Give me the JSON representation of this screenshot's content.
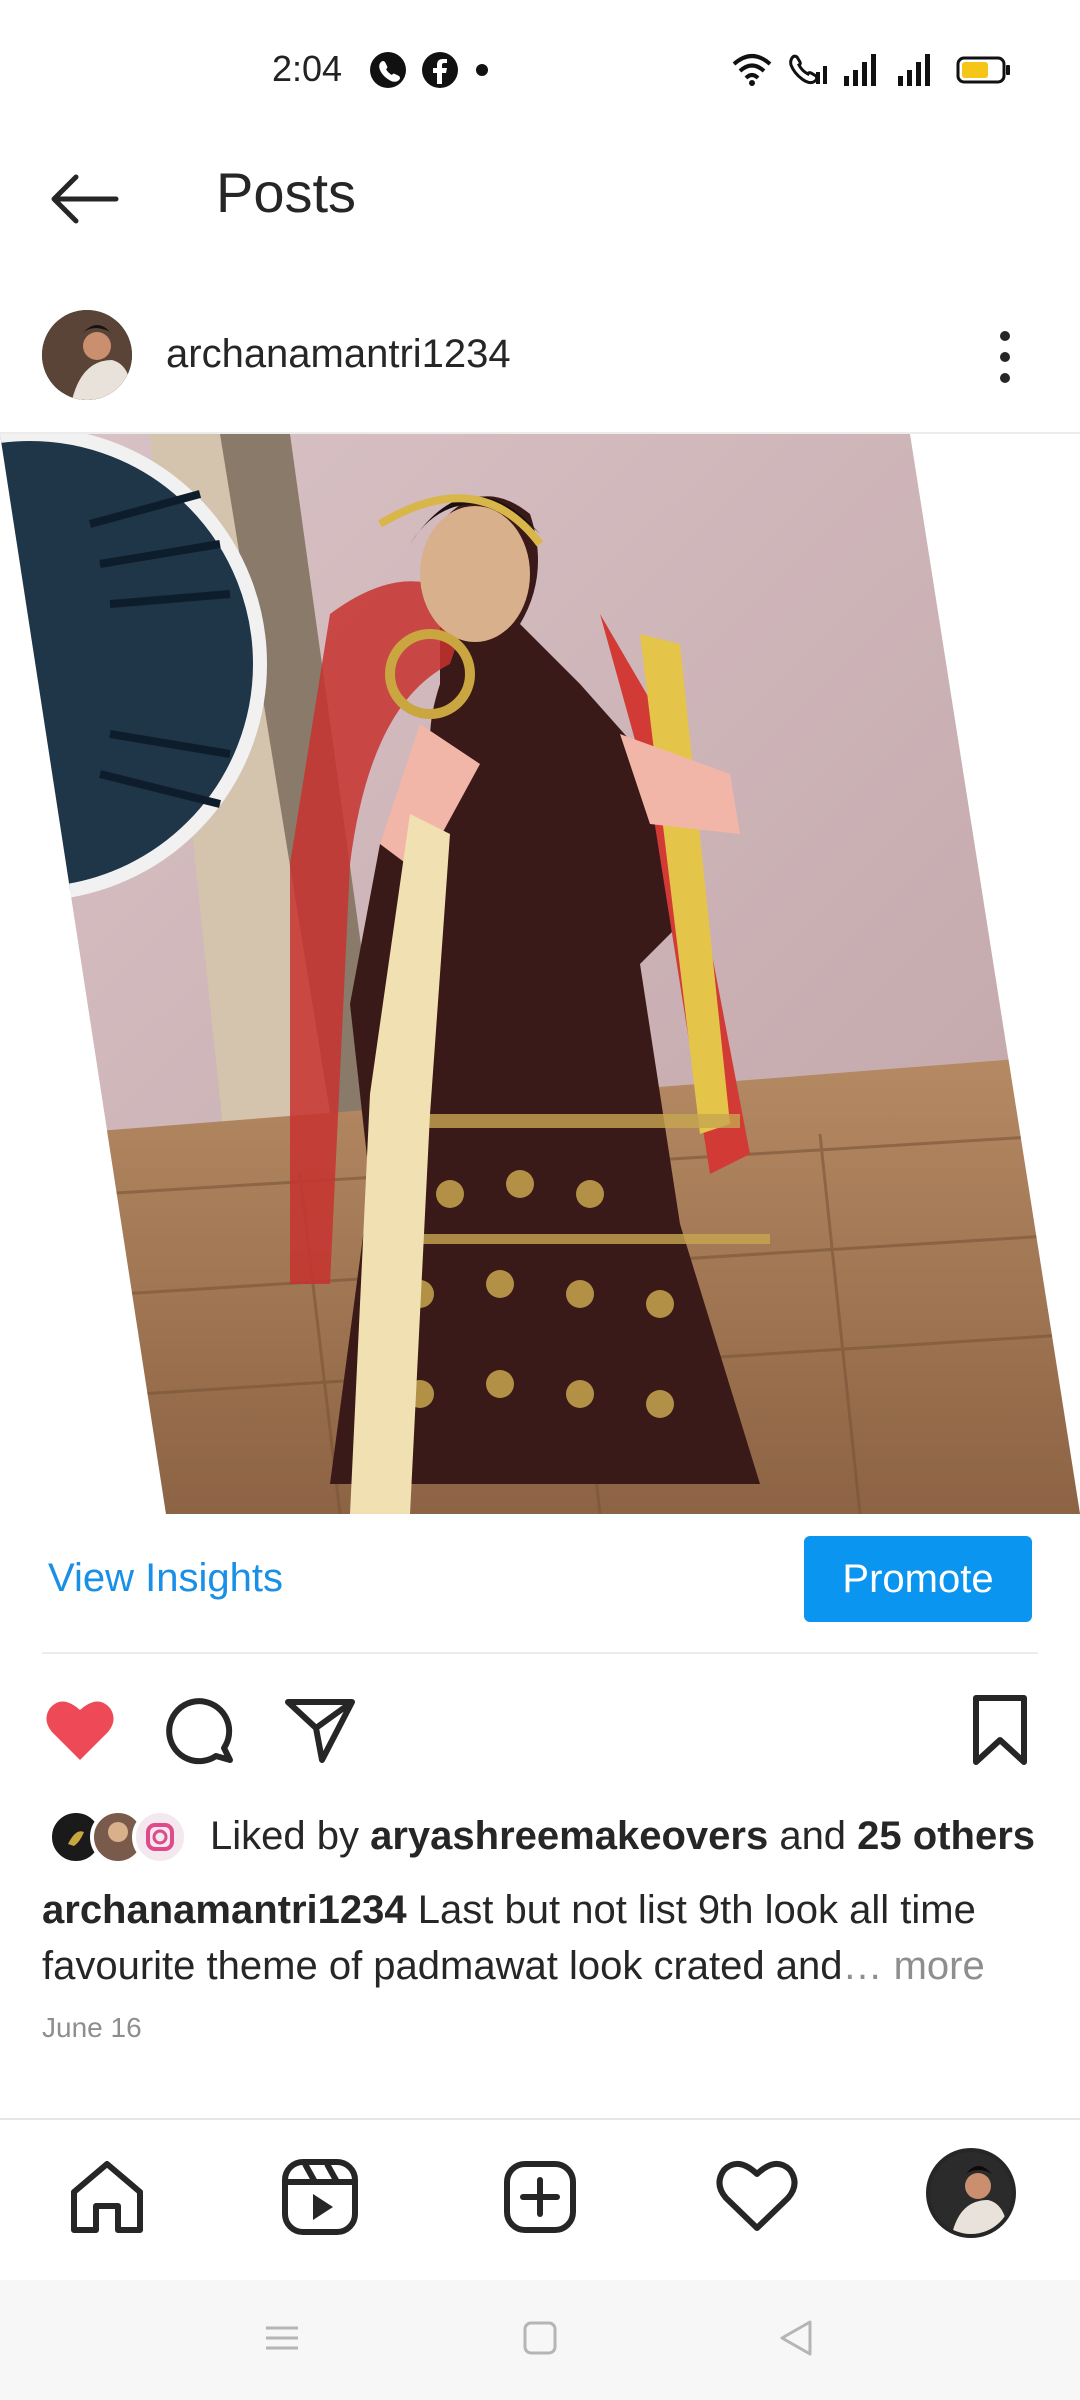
{
  "status_bar": {
    "time": "2:04",
    "icons": [
      "whatsapp-icon",
      "facebook-icon",
      "notification-dot-icon",
      "wifi-icon",
      "wifi-calling-icon",
      "signal-icon",
      "signal-icon",
      "battery-icon"
    ]
  },
  "header": {
    "title": "Posts",
    "back_icon": "back-arrow-icon"
  },
  "post": {
    "username": "archanamantri1234",
    "menu_icon": "more-vertical-icon",
    "insights": {
      "view_label": "View Insights",
      "promote_label": "Promote"
    },
    "actions": {
      "like_icon": "heart-filled-icon",
      "comment_icon": "comment-icon",
      "share_icon": "share-icon",
      "save_icon": "bookmark-icon"
    },
    "likes": {
      "prefix": "Liked by ",
      "user": "aryashreemakeovers",
      "middle": " and ",
      "others": "25 others"
    },
    "caption": {
      "username": "archanamantri1234",
      "text": " Last but not list 9th look all time favourite theme of  padmawat look crated and",
      "ellipsis": "…",
      "more": " more"
    },
    "date": "June 16"
  },
  "bottom_nav": {
    "items": [
      "home-icon",
      "reels-icon",
      "create-icon",
      "activity-icon",
      "profile-avatar"
    ]
  },
  "colors": {
    "accent": "#0095f6",
    "like": "#ed4956",
    "text": "#262626",
    "muted": "#8e8e8e"
  }
}
